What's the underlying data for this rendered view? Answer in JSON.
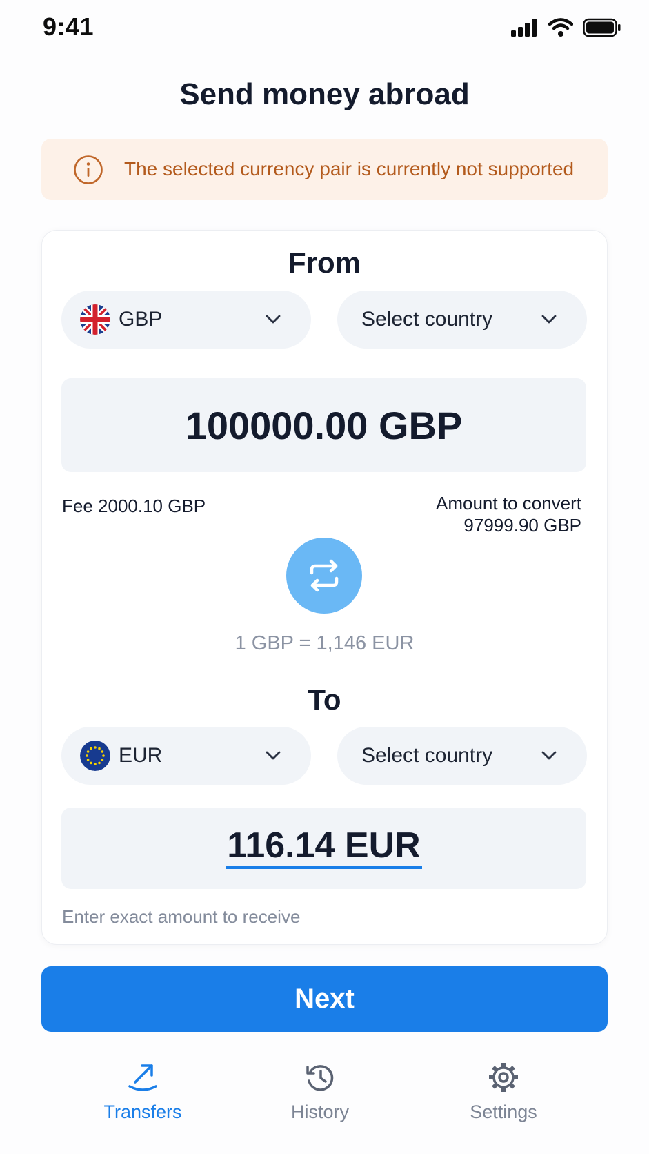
{
  "status_bar": {
    "time": "9:41"
  },
  "page": {
    "title": "Send money abroad"
  },
  "alert": {
    "message": "The selected currency pair is currently not supported",
    "icon": "info-icon"
  },
  "from": {
    "title": "From",
    "currency": "GBP",
    "country_placeholder": "Select country",
    "amount": "100000.00 GBP",
    "fee": "Fee 2000.10 GBP",
    "convert_label": "Amount to convert",
    "convert_value": "97999.90 GBP"
  },
  "rate": "1 GBP = 1,146 EUR",
  "to": {
    "title": "To",
    "currency": "EUR",
    "country_placeholder": "Select country",
    "amount": "116.14 EUR",
    "hint": "Enter exact amount to receive"
  },
  "next_label": "Next",
  "tabs": [
    {
      "label": "Transfers",
      "icon": "send-arrow-icon",
      "active": true
    },
    {
      "label": "History",
      "icon": "history-icon",
      "active": false
    },
    {
      "label": "Settings",
      "icon": "gear-icon",
      "active": false
    }
  ],
  "colors": {
    "primary": "#1a7ee8",
    "swap": "#6ab8f5",
    "alert_bg": "#fdf1e8",
    "alert_text": "#b35a1c"
  }
}
